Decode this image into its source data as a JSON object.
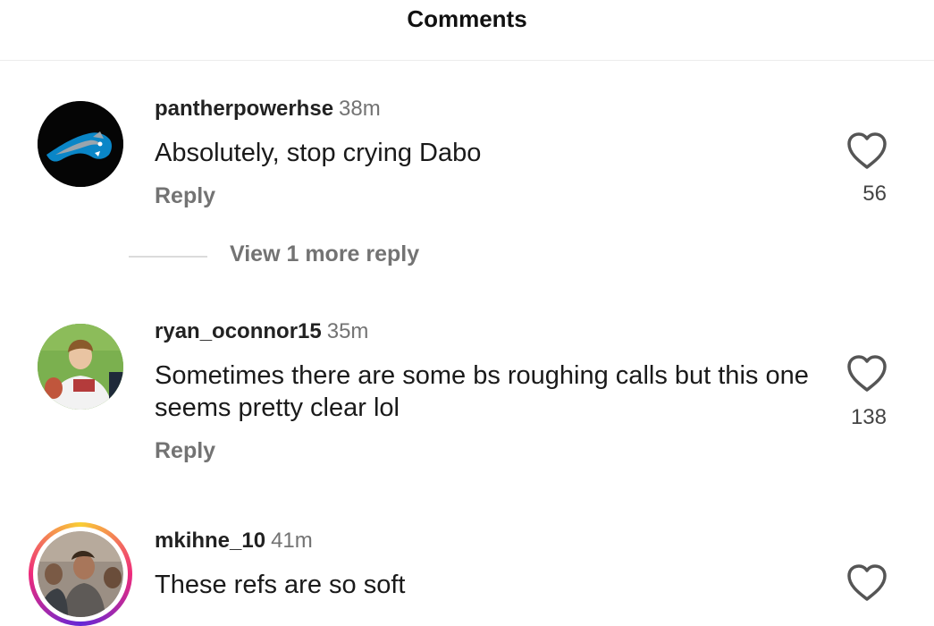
{
  "header": {
    "title": "Comments"
  },
  "comments": [
    {
      "username": "pantherpowerhse",
      "time": "38m",
      "text": "Absolutely, stop crying Dabo",
      "reply_label": "Reply",
      "likes": "56",
      "view_more": "View 1 more reply"
    },
    {
      "username": "ryan_oconnor15",
      "time": "35m",
      "text": "Sometimes there are some bs roughing calls but this one seems pretty clear lol",
      "reply_label": "Reply",
      "likes": "138"
    },
    {
      "username": "mkihne_10",
      "time": "41m",
      "text": "These refs are so soft"
    }
  ],
  "colors": {
    "secondary_text": "#737373",
    "divider": "#dbdbdb",
    "story_ring_start": "#f9ce34",
    "story_ring_mid": "#ee2a7b",
    "story_ring_end": "#6228d7"
  },
  "icons": [
    "heart-icon",
    "avatar"
  ]
}
